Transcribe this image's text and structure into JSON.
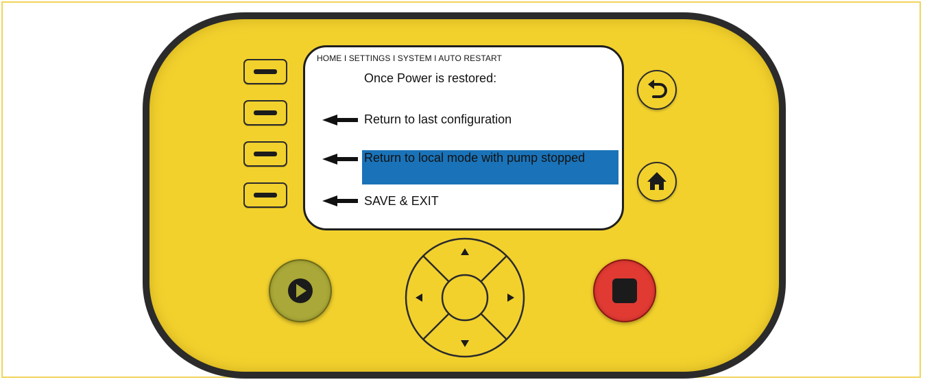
{
  "screen": {
    "breadcrumb": "HOME I SETTINGS I SYSTEM I AUTO RESTART",
    "title": "Once Power is restored:",
    "options": [
      {
        "label": "Return to last configuration",
        "selected": false
      },
      {
        "label": "Return to local mode with pump stopped",
        "selected": true
      },
      {
        "label": "SAVE & EXIT",
        "selected": false
      }
    ]
  },
  "colors": {
    "device_body": "#f2d12d",
    "selection": "#1a73b9",
    "play_button": "#a9a838",
    "stop_button": "#e03a33"
  },
  "icons": {
    "soft_keys": "minus-bar",
    "back": "return-arrow-icon",
    "home": "house-icon",
    "play": "play-icon",
    "stop": "stop-icon",
    "dpad": [
      "up-arrow-icon",
      "down-arrow-icon",
      "left-arrow-icon",
      "right-arrow-icon"
    ]
  }
}
